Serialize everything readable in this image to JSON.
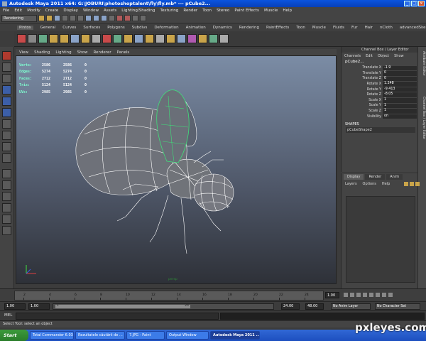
{
  "window": {
    "title": "Autodesk Maya 2011 x64: G:\\JOBURI\\photoshoptalent\\fly\\fly.mb*  ---  pCube2..."
  },
  "menubar": [
    "File",
    "Edit",
    "Modify",
    "Create",
    "Display",
    "Window",
    "Assets",
    "Lighting/Shading",
    "Texturing",
    "Render",
    "Toon",
    "Stereo",
    "Paint Effects",
    "Muscle",
    "Help"
  ],
  "status_line": {
    "mode": "Rendering"
  },
  "shelf_tabs": [
    "Pintos",
    "General",
    "Curves",
    "Surfaces",
    "Polygons",
    "Subdivs",
    "Deformation",
    "Animation",
    "Dynamics",
    "Rendering",
    "PaintEffects",
    "Toon",
    "Muscle",
    "Fluids",
    "Fur",
    "Hair",
    "nCloth",
    "advancedSkeleton"
  ],
  "panel_menu": [
    "View",
    "Shading",
    "Lighting",
    "Show",
    "Renderer",
    "Panels"
  ],
  "hud": [
    {
      "label": "Verts:",
      "a": "2586",
      "b": "2586",
      "c": "0"
    },
    {
      "label": "Edges:",
      "a": "5274",
      "b": "5274",
      "c": "0"
    },
    {
      "label": "Faces:",
      "a": "2712",
      "b": "2712",
      "c": "0"
    },
    {
      "label": "Tris:",
      "a": "5124",
      "b": "5124",
      "c": "0"
    },
    {
      "label": "UVs:",
      "a": "2985",
      "b": "2985",
      "c": "0"
    }
  ],
  "viewport": {
    "camera": "persp"
  },
  "channel_box": {
    "title": "Channel Box / Layer Editor",
    "menu": [
      "Channels",
      "Edit",
      "Object",
      "Show"
    ],
    "object": "pCube2...",
    "attributes": [
      {
        "name": "Translate X",
        "value": "-1.9"
      },
      {
        "name": "Translate Y",
        "value": "0"
      },
      {
        "name": "Translate Z",
        "value": "0"
      },
      {
        "name": "Rotate X",
        "value": "1.248"
      },
      {
        "name": "Rotate Y",
        "value": "-9.413"
      },
      {
        "name": "Rotate Z",
        "value": "-8.05"
      },
      {
        "name": "Scale X",
        "value": "1"
      },
      {
        "name": "Scale Y",
        "value": "1"
      },
      {
        "name": "Scale Z",
        "value": "1"
      },
      {
        "name": "Visibility",
        "value": "on"
      }
    ],
    "shapes_header": "SHAPES",
    "shape": "pCubeShape2"
  },
  "right_tabs": [
    "Attribute Editor",
    "Channel Box / Layer Editor"
  ],
  "layer_editor": {
    "tabs": [
      "Display",
      "Render",
      "Anim"
    ],
    "menu": [
      "Layers",
      "Options",
      "Help"
    ]
  },
  "time_slider": {
    "ticks": [
      "2",
      "4",
      "6",
      "8",
      "10",
      "12",
      "14",
      "16",
      "18",
      "20",
      "22",
      "24"
    ],
    "current": "1.00"
  },
  "range_slider": {
    "start": "1.00",
    "playback_start": "1.00",
    "thumb_start": "1",
    "thumb_end": "24",
    "playback_end": "24.00",
    "end": "48.00",
    "anim_layer": "No Anim Layer",
    "character_set": "No Character Set"
  },
  "command_line": {
    "label": "MEL"
  },
  "help_line": {
    "text": "Select Tool: select an object"
  },
  "taskbar": {
    "start": "Start",
    "tasks": [
      "Total Commander 6.03 - ...",
      "Rezultatele căutării de ...",
      "7.JPG - Paint",
      "Output Window",
      "Autodesk Maya 2011 ..."
    ]
  },
  "watermark": "pxleyes.com",
  "colors": {
    "viewport_top": "#7b8ca5",
    "viewport_bottom": "#2e3138",
    "hud_label": "#7fffd0",
    "wireframe": "#ffffff",
    "selected_wire": "#3fe07a"
  }
}
